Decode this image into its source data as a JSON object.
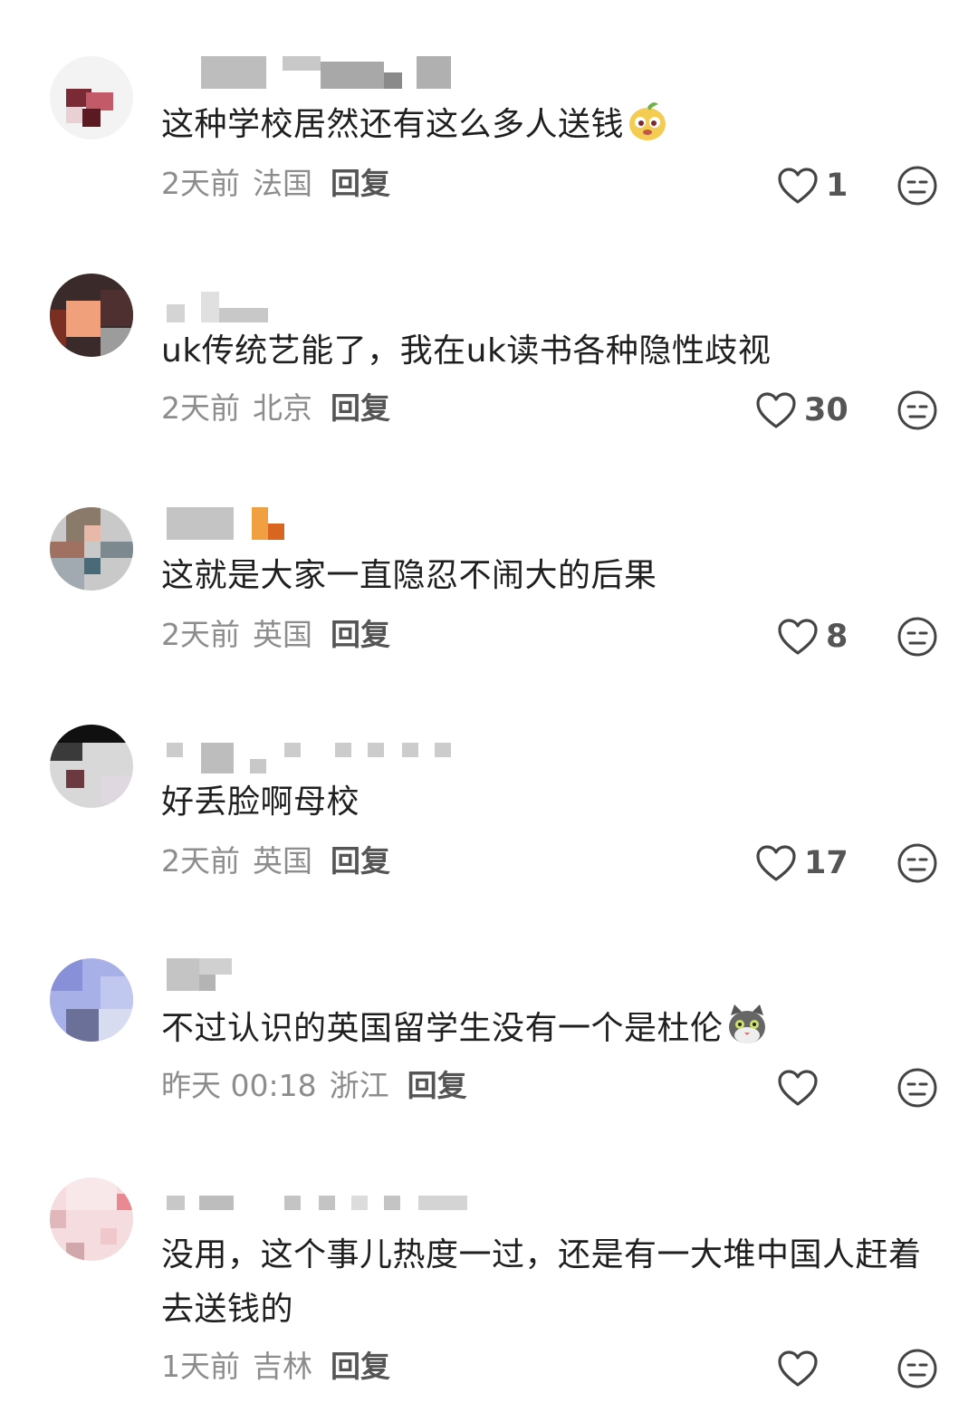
{
  "comments": [
    {
      "text": "这种学校居然还有这么多人送钱",
      "emoji": "pear-face-emoji",
      "time": "2天前",
      "location": "法国",
      "reply_label": "回复",
      "likes": "1"
    },
    {
      "text": "uk传统艺能了，我在uk读书各种隐性歧视",
      "time": "2天前",
      "location": "北京",
      "reply_label": "回复",
      "likes": "30"
    },
    {
      "text": "这就是大家一直隐忍不闹大的后果",
      "time": "2天前",
      "location": "英国",
      "reply_label": "回复",
      "likes": "8"
    },
    {
      "text": "好丢脸啊母校",
      "time": "2天前",
      "location": "英国",
      "reply_label": "回复",
      "likes": "17"
    },
    {
      "text": "不过认识的英国留学生没有一个是杜伦",
      "emoji": "cat-face-emoji",
      "time": "昨天 00:18",
      "location": "浙江",
      "reply_label": "回复",
      "likes": ""
    },
    {
      "text": "没用，这个事儿热度一过，还是有一大堆中国人赶着去送钱的",
      "time": "1天前",
      "location": "吉林",
      "reply_label": "回复",
      "likes": ""
    }
  ],
  "colors": {
    "text": "#1f1f1f",
    "meta": "#8d8d8d",
    "reply": "#555555",
    "icon": "#444444"
  },
  "icons": {
    "like": "heart-outline-icon",
    "dislike": "neutral-face-icon"
  }
}
